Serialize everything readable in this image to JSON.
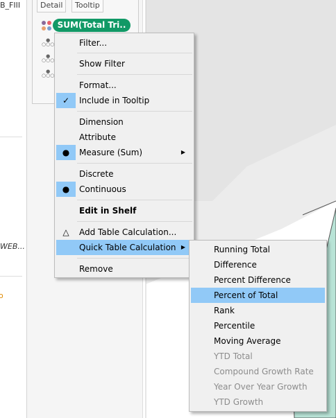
{
  "left": {
    "top_text": "B_FIII",
    "mid_text": "WEB...",
    "bottom_text": "o"
  },
  "marks": {
    "detail": "Detail",
    "tooltip": "Tooltip",
    "pill": "SUM(Total Tri.."
  },
  "menu": {
    "filter": "Filter...",
    "show_filter": "Show Filter",
    "format": "Format...",
    "include_tooltip": "Include in Tooltip",
    "dimension": "Dimension",
    "attribute": "Attribute",
    "measure": "Measure (Sum)",
    "discrete": "Discrete",
    "continuous": "Continuous",
    "edit_shelf": "Edit in Shelf",
    "add_table_calc": "Add Table Calculation...",
    "quick_table_calc": "Quick Table Calculation",
    "remove": "Remove"
  },
  "submenu": {
    "items": [
      "Running Total",
      "Difference",
      "Percent Difference",
      "Percent of Total",
      "Rank",
      "Percentile",
      "Moving Average",
      "YTD Total",
      "Compound Growth Rate",
      "Year Over Year Growth",
      "YTD Growth"
    ]
  },
  "colors": {
    "pill": "#119966",
    "highlight": "#91c9f7",
    "map_fill": "#b8e3d6"
  }
}
